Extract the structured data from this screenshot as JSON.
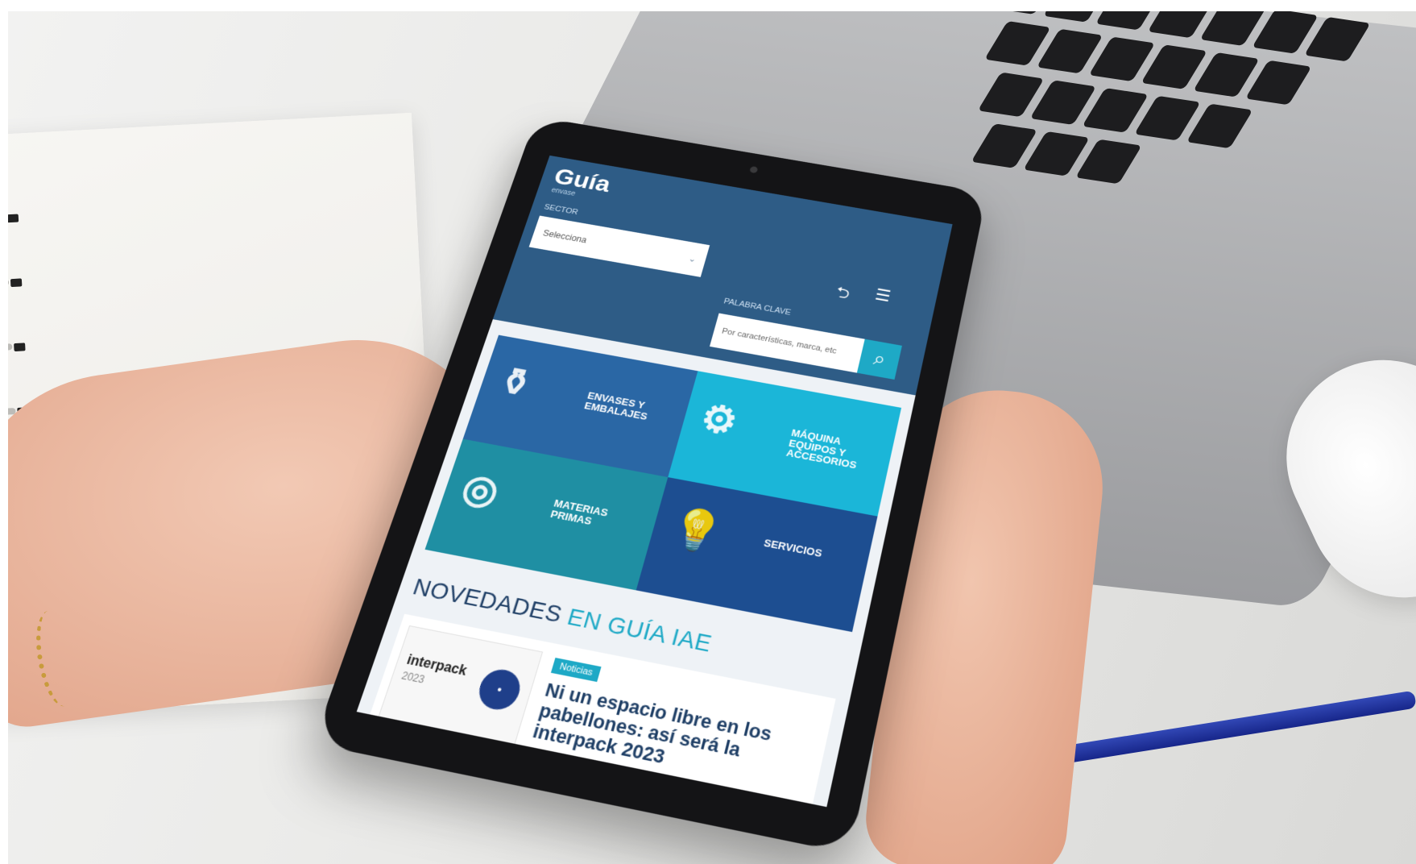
{
  "site": {
    "logo": "Guía",
    "logo_sub": "envase"
  },
  "search": {
    "sector_label": "SECTOR",
    "sector_value": "Selecciona",
    "keyword_label": "PALABRA CLAVE",
    "keyword_placeholder": "Por características, marca, etc"
  },
  "categories": [
    {
      "label": "ENVASES Y EMBALAJES",
      "icon": "bottles-icon"
    },
    {
      "label": "MÁQUINA EQUIPOS Y ACCESORIOS",
      "icon": "gears-icon"
    },
    {
      "label": "MATERIAS PRIMAS",
      "icon": "rolls-icon"
    },
    {
      "label": "SERVICIOS",
      "icon": "lightbulb-icon"
    }
  ],
  "news": {
    "section_title_prefix": "NOVEDADES",
    "section_title_accent": "EN GUÍA IAE",
    "card": {
      "thumb_title": "interpack",
      "thumb_year": "2023",
      "tag": "Noticias",
      "headline": "Ni un espacio libre en los pabellones: así será la interpack 2023"
    }
  }
}
